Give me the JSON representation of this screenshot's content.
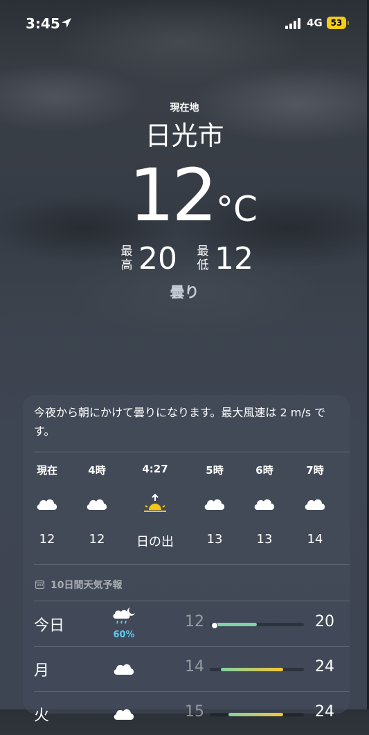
{
  "status_bar": {
    "time": "3:45",
    "network": "4G",
    "battery": "53"
  },
  "header": {
    "my_location": "現在地",
    "city": "日光市",
    "temperature": "12",
    "unit": "°C",
    "high_label_1": "最",
    "high_label_2": "高",
    "high": "20",
    "low_label_1": "最",
    "low_label_2": "低",
    "low": "12",
    "condition": "曇り"
  },
  "forecast_card": {
    "summary": "今夜から朝にかけて曇りになります。最大風速は 2 m/s です。",
    "hourly": [
      {
        "label": "現在",
        "icon": "cloud-icon",
        "temp": "12"
      },
      {
        "label": "4時",
        "icon": "cloud-icon",
        "temp": "12"
      },
      {
        "label": "4:27",
        "icon": "sunrise-icon",
        "temp": "日の出"
      },
      {
        "label": "5時",
        "icon": "cloud-icon",
        "temp": "13"
      },
      {
        "label": "6時",
        "icon": "cloud-icon",
        "temp": "13"
      },
      {
        "label": "7時",
        "icon": "cloud-icon",
        "temp": "14"
      }
    ],
    "ten_day_label": "10日間天気予報",
    "days": [
      {
        "name": "今日",
        "icon": "cloud-moon-rain-icon",
        "precip": "60%",
        "low": "12",
        "high": "20",
        "range_start": 0.02,
        "range_end": 0.5
      },
      {
        "name": "月",
        "icon": "cloud-icon",
        "precip": "",
        "low": "14",
        "high": "24",
        "range_start": 0.12,
        "range_end": 0.78
      },
      {
        "name": "火",
        "icon": "cloud-icon",
        "precip": "",
        "low": "15",
        "high": "24",
        "range_start": 0.2,
        "range_end": 0.78
      }
    ]
  },
  "colors": {
    "sunrise": "#f5c518",
    "precip": "#5ec8f2",
    "bar_cool": "#7fd3a6",
    "bar_warm": "#f7c531"
  }
}
